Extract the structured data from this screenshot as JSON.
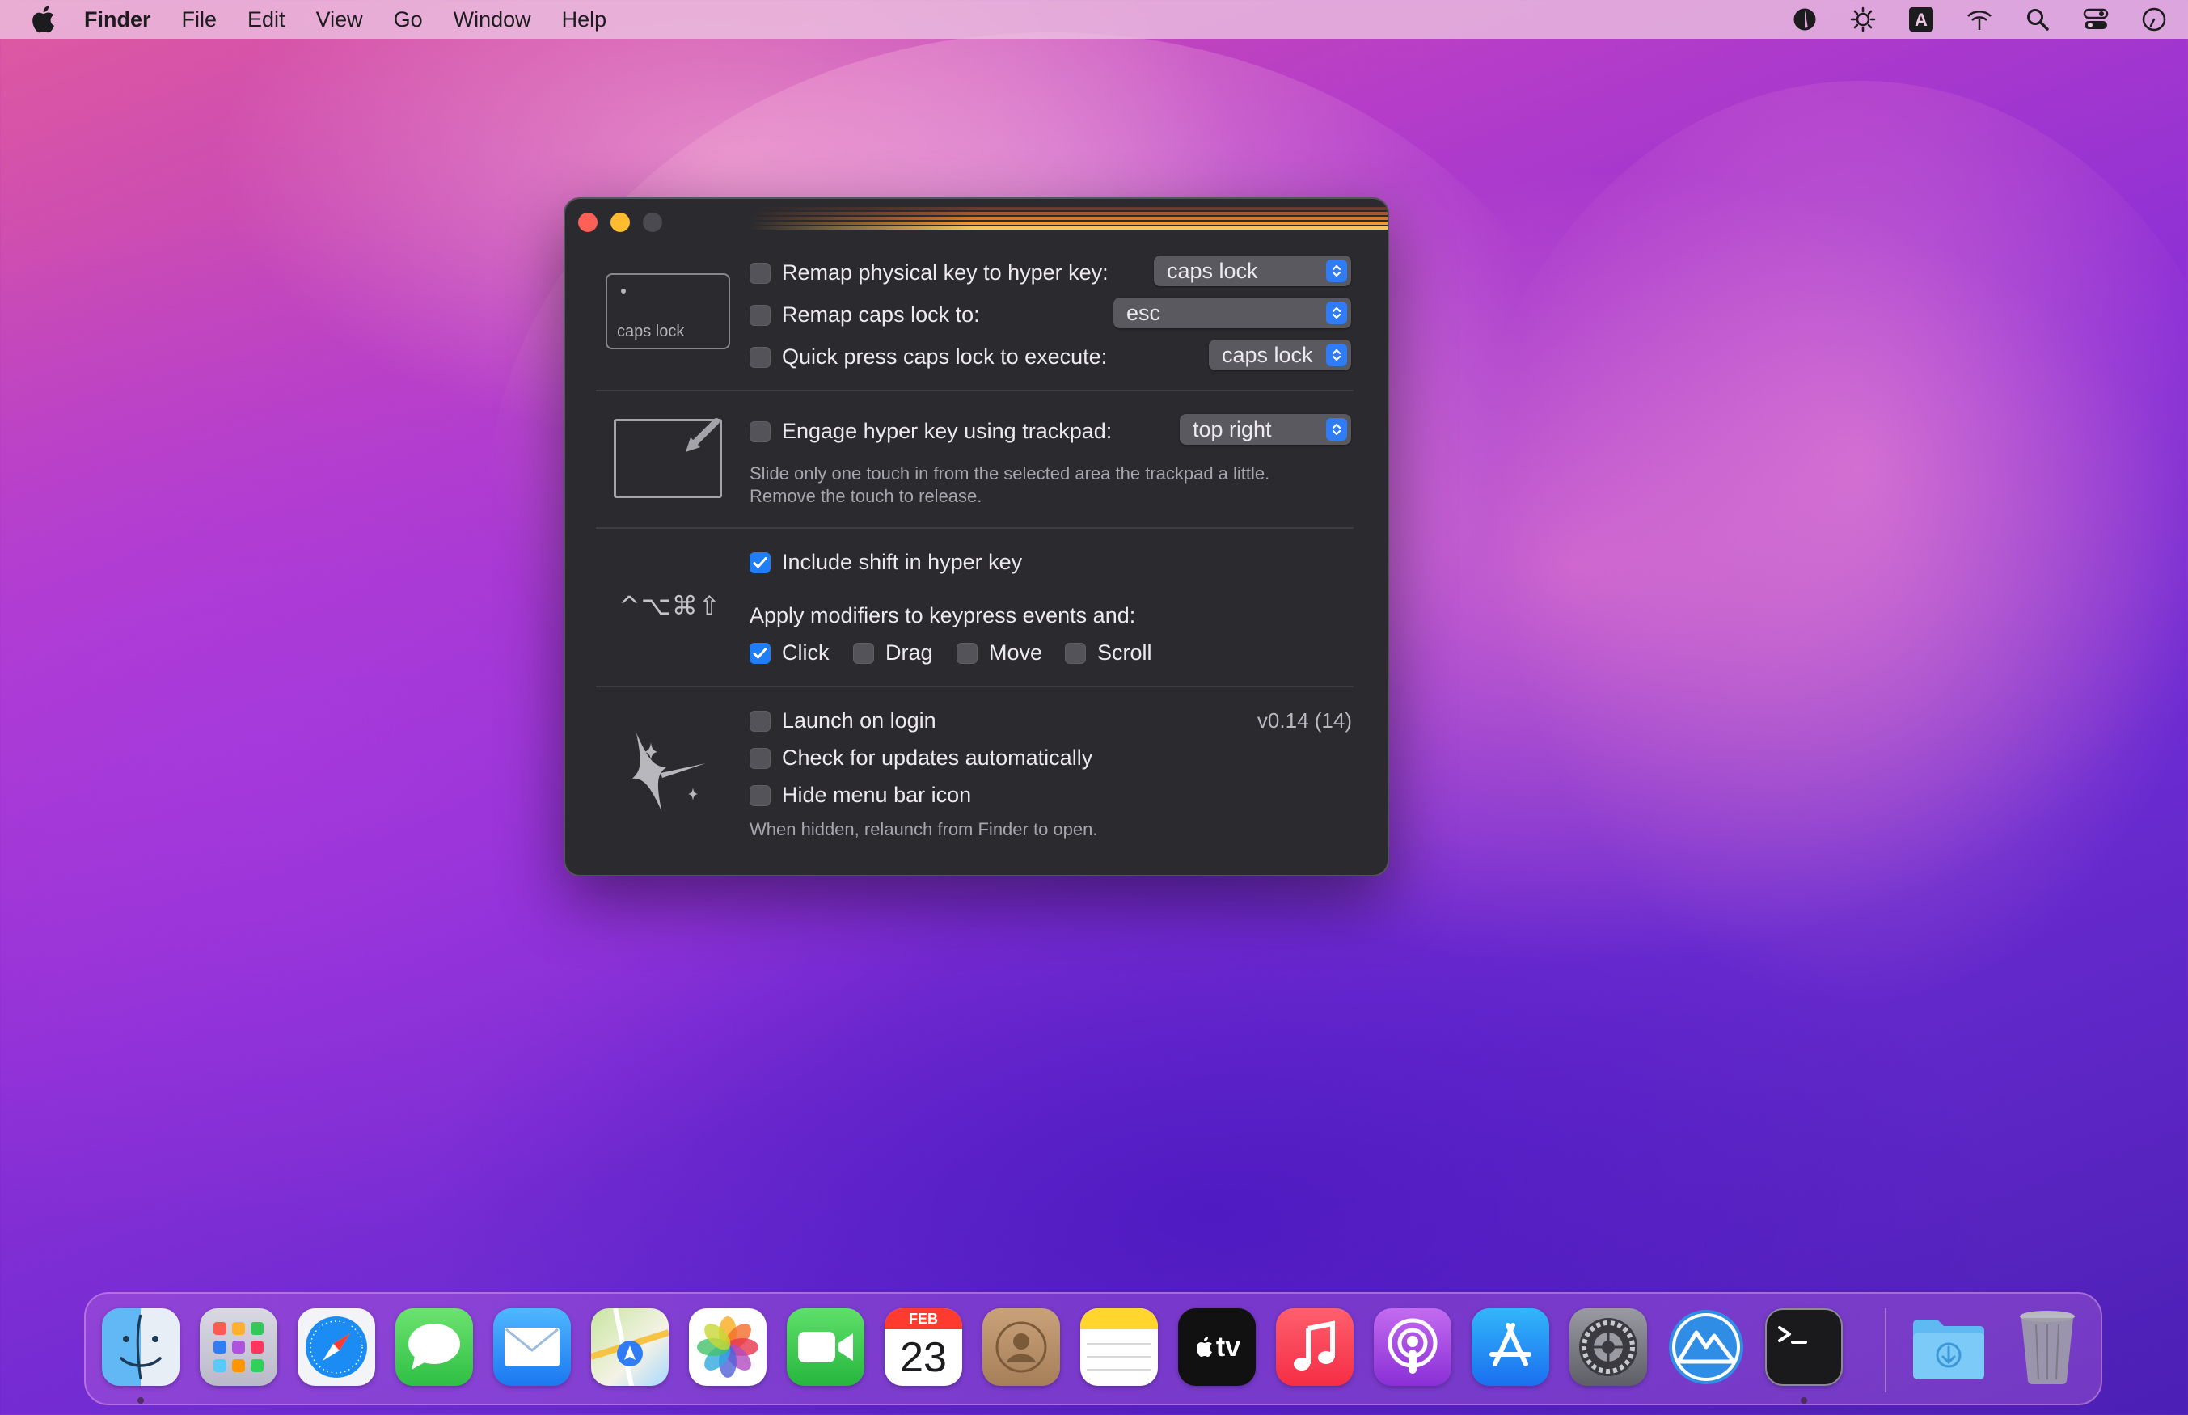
{
  "menubar": {
    "apple_icon": "apple-logo-icon",
    "items": [
      "Finder",
      "File",
      "Edit",
      "View",
      "Go",
      "Window",
      "Help"
    ],
    "status_icons": [
      "moon-half-icon",
      "brightness-gear-icon",
      "keyboard-input-a-icon",
      "wifi-icon",
      "search-icon",
      "control-center-icon",
      "clock-icon"
    ]
  },
  "window": {
    "caps_box_label": "caps lock",
    "remap_physical": {
      "label": "Remap physical key to hyper key:",
      "checked": false,
      "value": "caps lock"
    },
    "remap_caps": {
      "label": "Remap caps lock to:",
      "checked": false,
      "value": "esc"
    },
    "quick_press": {
      "label": "Quick press caps lock to execute:",
      "checked": false,
      "value": "caps lock"
    },
    "trackpad": {
      "label": "Engage hyper key using trackpad:",
      "checked": false,
      "value": "top right",
      "note_line1": "Slide only one touch in from the selected area the trackpad a little.",
      "note_line2": "Remove the touch to release."
    },
    "modifier_symbols": "^⌥⌘⇧",
    "include_shift": {
      "label": "Include shift in hyper key",
      "checked": true
    },
    "apply_modifiers_label": "Apply modifiers to keypress events and:",
    "events": {
      "click": {
        "label": "Click",
        "checked": true
      },
      "drag": {
        "label": "Drag",
        "checked": false
      },
      "move": {
        "label": "Move",
        "checked": false
      },
      "scroll": {
        "label": "Scroll",
        "checked": false
      }
    },
    "launch_on_login": {
      "label": "Launch on login",
      "checked": false
    },
    "check_updates": {
      "label": "Check for updates automatically",
      "checked": false
    },
    "hide_menu_icon": {
      "label": "Hide menu bar icon",
      "checked": false
    },
    "hidden_note": "When hidden, relaunch from Finder to open.",
    "version": "v0.14 (14)"
  },
  "dock": {
    "calendar": {
      "month": "FEB",
      "day": "23"
    },
    "tv_label": "tv",
    "apps": [
      "Finder",
      "Launchpad",
      "Safari",
      "Messages",
      "Mail",
      "Maps",
      "Photos",
      "FaceTime",
      "Calendar",
      "Contacts",
      "Notes",
      "TV",
      "Music",
      "Podcasts",
      "App Store",
      "System Preferences",
      "Hyperkey",
      "Terminal",
      "Downloads",
      "Trash"
    ]
  },
  "colors": {
    "accent": "#1f7ef5",
    "window_bg": "#2b2a2f",
    "close": "#fe5f57",
    "minimize": "#febc2e"
  }
}
